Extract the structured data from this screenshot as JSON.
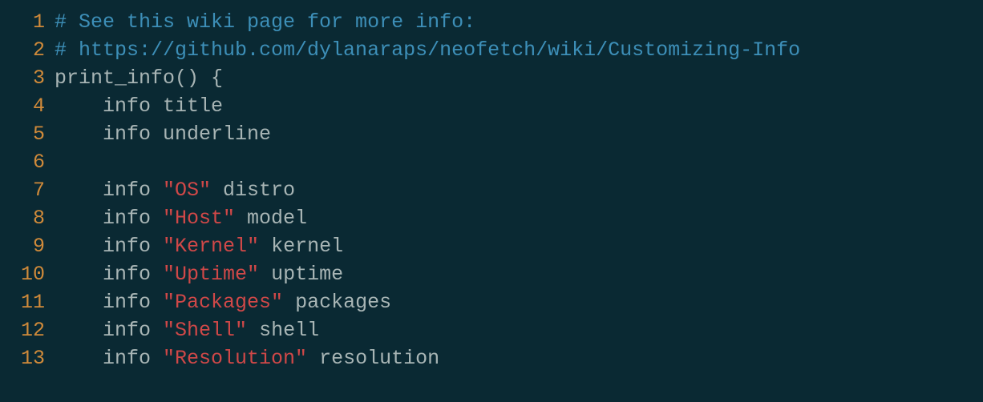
{
  "lines": [
    {
      "num": "1",
      "tokens": [
        {
          "cls": "comment",
          "text": "# See this wiki page for more info:"
        }
      ]
    },
    {
      "num": "2",
      "tokens": [
        {
          "cls": "comment",
          "text": "# https://github.com/dylanaraps/neofetch/wiki/Customizing-Info"
        }
      ]
    },
    {
      "num": "3",
      "tokens": [
        {
          "cls": "default",
          "text": "print_info() {"
        }
      ]
    },
    {
      "num": "4",
      "tokens": [
        {
          "cls": "default",
          "text": "    info title"
        }
      ]
    },
    {
      "num": "5",
      "tokens": [
        {
          "cls": "default",
          "text": "    info underline"
        }
      ]
    },
    {
      "num": "6",
      "tokens": [
        {
          "cls": "default",
          "text": ""
        }
      ]
    },
    {
      "num": "7",
      "tokens": [
        {
          "cls": "default",
          "text": "    info "
        },
        {
          "cls": "string",
          "text": "\"OS\""
        },
        {
          "cls": "default",
          "text": " distro"
        }
      ]
    },
    {
      "num": "8",
      "tokens": [
        {
          "cls": "default",
          "text": "    info "
        },
        {
          "cls": "string",
          "text": "\"Host\""
        },
        {
          "cls": "default",
          "text": " model"
        }
      ]
    },
    {
      "num": "9",
      "tokens": [
        {
          "cls": "default",
          "text": "    info "
        },
        {
          "cls": "string",
          "text": "\"Kernel\""
        },
        {
          "cls": "default",
          "text": " kernel"
        }
      ]
    },
    {
      "num": "10",
      "tokens": [
        {
          "cls": "default",
          "text": "    info "
        },
        {
          "cls": "string",
          "text": "\"Uptime\""
        },
        {
          "cls": "default",
          "text": " uptime"
        }
      ]
    },
    {
      "num": "11",
      "tokens": [
        {
          "cls": "default",
          "text": "    info "
        },
        {
          "cls": "string",
          "text": "\"Packages\""
        },
        {
          "cls": "default",
          "text": " packages"
        }
      ]
    },
    {
      "num": "12",
      "tokens": [
        {
          "cls": "default",
          "text": "    info "
        },
        {
          "cls": "string",
          "text": "\"Shell\""
        },
        {
          "cls": "default",
          "text": " shell"
        }
      ]
    },
    {
      "num": "13",
      "tokens": [
        {
          "cls": "default",
          "text": "    info "
        },
        {
          "cls": "string",
          "text": "\"Resolution\""
        },
        {
          "cls": "default",
          "text": " resolution"
        }
      ]
    }
  ]
}
